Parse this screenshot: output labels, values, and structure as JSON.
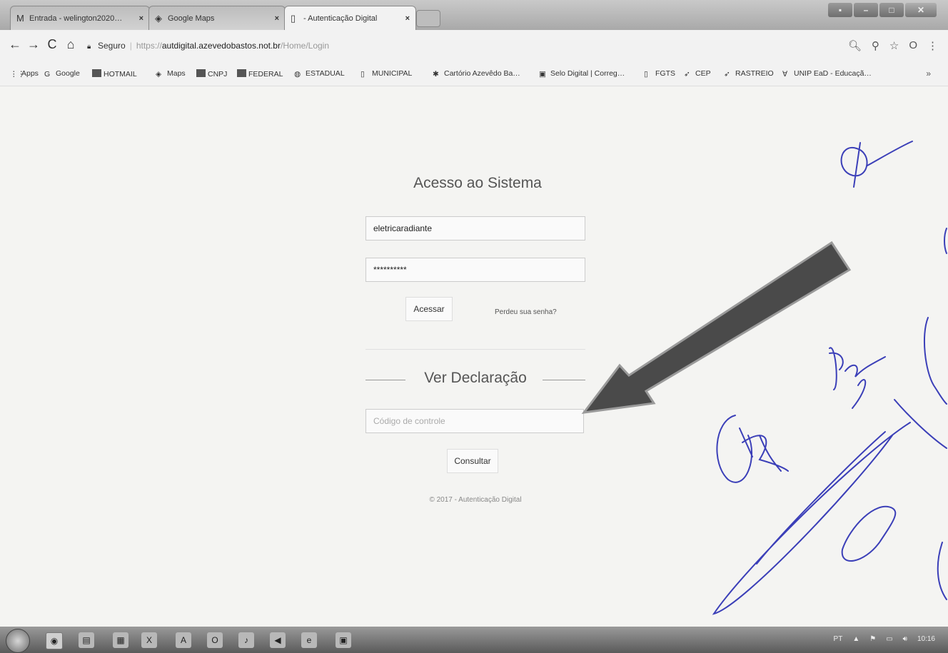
{
  "browser": {
    "tabs": [
      {
        "label": "Entrada - welington2020…",
        "icon": "gmail-icon"
      },
      {
        "label": "Google Maps",
        "icon": "maps-icon"
      },
      {
        "label": "- Autenticação Digital",
        "icon": "page-icon",
        "active": true
      }
    ],
    "address": {
      "secure_label": "Seguro",
      "url_scheme": "https://",
      "url_host": "autdigital.azevedobastos.not.br",
      "url_path": "/Home/Login"
    },
    "bookmarks": [
      {
        "label": "Apps",
        "icon": "apps-grid-icon"
      },
      {
        "label": "Google",
        "icon": "google-icon"
      },
      {
        "label": "HOTMAIL",
        "icon": "windows-icon"
      },
      {
        "label": "Maps",
        "icon": "maps-icon"
      },
      {
        "label": "CNPJ",
        "icon": "gov-icon"
      },
      {
        "label": "FEDERAL",
        "icon": "gov-icon"
      },
      {
        "label": "ESTADUAL",
        "icon": "globe-icon"
      },
      {
        "label": "MUNICIPAL",
        "icon": "page-icon"
      },
      {
        "label": "Cartório Azevêdo Ba…",
        "icon": "emblem-icon"
      },
      {
        "label": "Selo Digital | Correg…",
        "icon": "seal-icon"
      },
      {
        "label": "FGTS",
        "icon": "page-icon"
      },
      {
        "label": "CEP",
        "icon": "mail-bird-icon"
      },
      {
        "label": "RASTREIO",
        "icon": "mail-bird-icon"
      },
      {
        "label": "UNIP EaD - Educaçã…",
        "icon": "unip-icon"
      }
    ],
    "more_label": "»"
  },
  "login": {
    "title": "Acesso ao Sistema",
    "username_value": "eletricaradiante",
    "password_value": "**********",
    "submit_label": "Acessar",
    "forgot_label": "Perdeu sua senha?"
  },
  "declaration": {
    "title": "Ver Declaração",
    "code_placeholder": "Código de controle",
    "submit_label": "Consultar"
  },
  "footer": {
    "copyright": "© 2017 - Autenticação Digital"
  },
  "taskbar": {
    "language": "PT",
    "time": "10:16"
  }
}
